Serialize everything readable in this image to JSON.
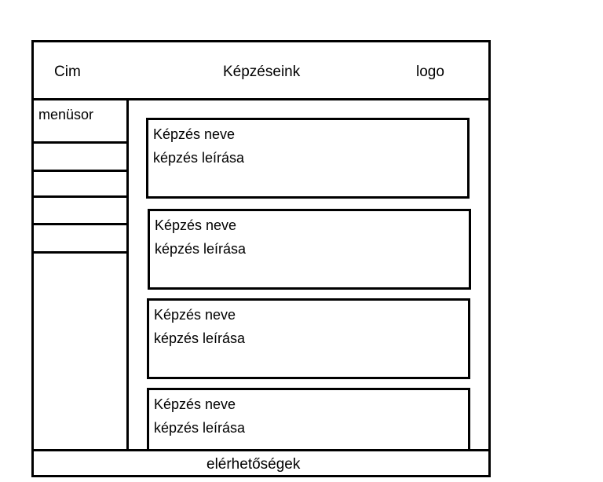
{
  "header": {
    "title": "Cim",
    "nav_label": "Képzéseink",
    "logo": "logo"
  },
  "sidebar": {
    "title": "menüsor",
    "items": [
      "",
      "",
      "",
      "",
      ""
    ]
  },
  "courses": [
    {
      "name": "Képzés neve",
      "description": "képzés leírása"
    },
    {
      "name": "Képzés neve",
      "description": "képzés leírása"
    },
    {
      "name": "Képzés neve",
      "description": "képzés leírása"
    },
    {
      "name": "Képzés neve",
      "description": "képzés leírása"
    }
  ],
  "footer": {
    "label": "elérhetőségek"
  }
}
